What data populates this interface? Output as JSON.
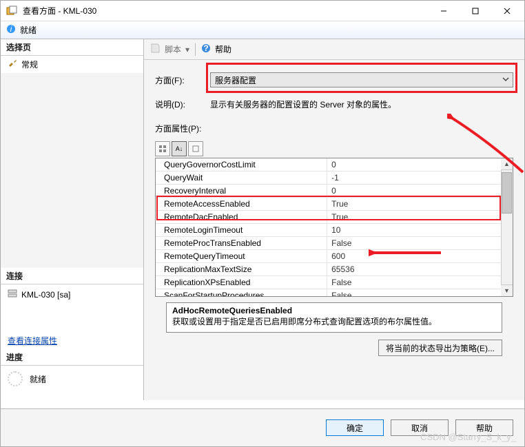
{
  "title": "查看方面 - KML-030",
  "ready_bar": "就绪",
  "left": {
    "select_page": "选择页",
    "general": "常规",
    "connection_hdr": "连接",
    "connection_value": "KML-030 [sa]",
    "view_conn_props": "查看连接属性",
    "progress_hdr": "进度",
    "ready": "就绪"
  },
  "toolbar": {
    "script": "脚本",
    "help": "帮助"
  },
  "form": {
    "facet_label": "方面(F):",
    "facet_value": "服务器配置",
    "desc_label": "说明(D):",
    "desc_value": "显示有关服务器的配置设置的 Server 对象的属性。",
    "props_label": "方面属性(P):"
  },
  "props": [
    {
      "name": "QueryGovernorCostLimit",
      "value": "0"
    },
    {
      "name": "QueryWait",
      "value": "-1"
    },
    {
      "name": "RecoveryInterval",
      "value": "0"
    },
    {
      "name": "RemoteAccessEnabled",
      "value": "True"
    },
    {
      "name": "RemoteDacEnabled",
      "value": "True"
    },
    {
      "name": "RemoteLoginTimeout",
      "value": "10"
    },
    {
      "name": "RemoteProcTransEnabled",
      "value": "False"
    },
    {
      "name": "RemoteQueryTimeout",
      "value": "600"
    },
    {
      "name": "ReplicationMaxTextSize",
      "value": "65536"
    },
    {
      "name": "ReplicationXPsEnabled",
      "value": "False"
    },
    {
      "name": "ScanForStartupProcedures",
      "value": "False"
    }
  ],
  "desc_box": {
    "name": "AdHocRemoteQueriesEnabled",
    "text": "获取或设置用于指定是否已启用即席分布式查询配置选项的布尔属性值。"
  },
  "export_btn": "将当前的状态导出为策略(E)...",
  "buttons": {
    "ok": "确定",
    "cancel": "取消",
    "help": "帮助"
  },
  "watermark": "CSDN @Starry_S_k_y_"
}
